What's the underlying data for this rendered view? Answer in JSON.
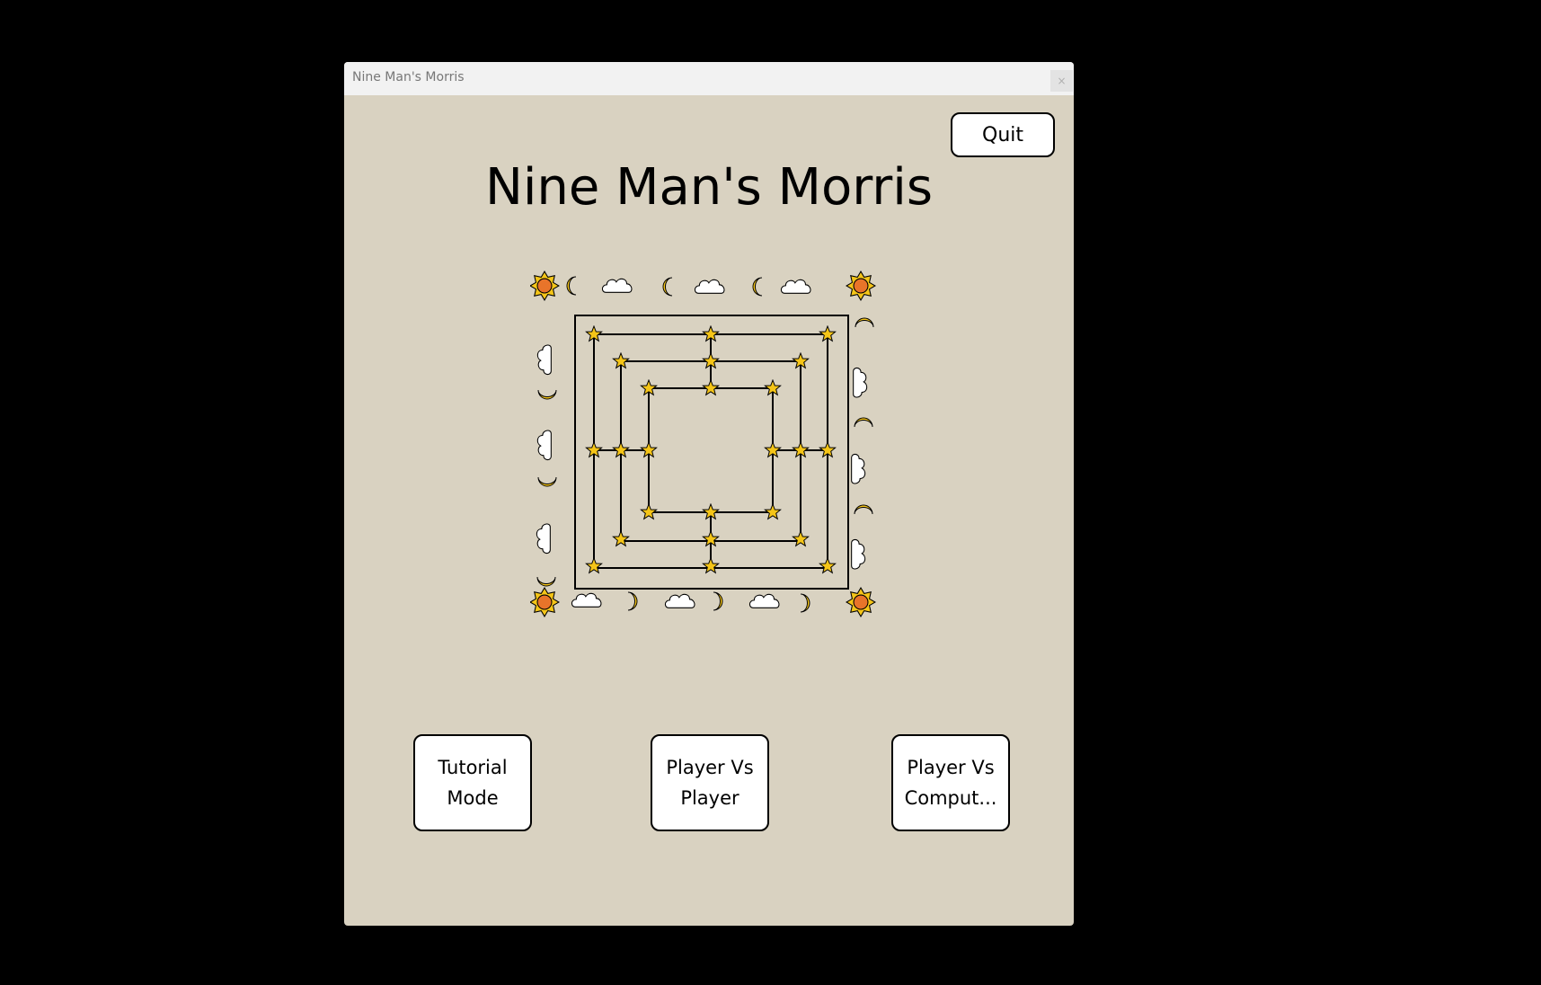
{
  "window": {
    "title": "Nine Man's Morris",
    "close_label": "×"
  },
  "toolbar": {
    "quit_label": "Quit"
  },
  "main": {
    "heading": "Nine Man's Morris"
  },
  "buttons": {
    "tutorial_label": "Tutorial Mode",
    "pvp_label": "Player Vs Player",
    "pvc_label": "Player Vs Comput..."
  },
  "colors": {
    "window_bg": "#d9d2c1",
    "star_fill": "#f5c518",
    "sun_core": "#e8742a",
    "cloud_fill": "#ffffff"
  },
  "icons": {
    "board_point": "star-icon",
    "corner": "sun-icon",
    "border_a": "moon-icon",
    "border_b": "cloud-icon"
  }
}
